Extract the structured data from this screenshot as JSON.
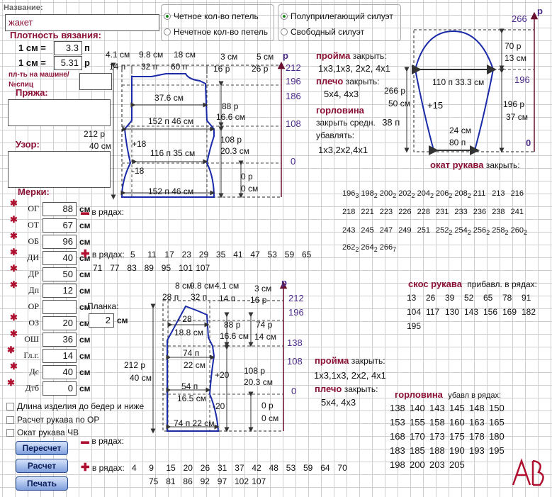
{
  "header": {
    "name_label": "Название:",
    "name_value": "жакет",
    "radio_even": "Четное кол-во петель",
    "radio_odd": "Нечетное кол-во петель",
    "radio_semi": "Полуприлегающий силуэт",
    "radio_free": "Свободный силуэт"
  },
  "density": {
    "title": "Плотность вязания:",
    "r1_left": "1 см =",
    "r1_value": "3.3",
    "r1_unit": "п",
    "r2_left": "1 см =",
    "r2_value": "5.31",
    "r2_unit": "р",
    "machine_label": "пл-ть на машине/",
    "needle_label": "№спиц"
  },
  "yarn_label": "Пряжа:",
  "pattern_label": "Узор:",
  "measures": {
    "title": "Мерки:",
    "unit": "см",
    "items": [
      {
        "label": "ОГ",
        "value": "88"
      },
      {
        "label": "ОТ",
        "value": "67"
      },
      {
        "label": "ОБ",
        "value": "96"
      },
      {
        "label": "ДИ",
        "value": "40"
      },
      {
        "label": "ДР",
        "value": "50"
      },
      {
        "label": "Дп",
        "value": "12"
      },
      {
        "label": "ОР",
        "value": ""
      },
      {
        "label": "ОЗ",
        "value": "20"
      },
      {
        "label": "ОШ",
        "value": "36"
      },
      {
        "label": "Гл.г.",
        "value": "14"
      },
      {
        "label": "Дс",
        "value": "40"
      },
      {
        "label": "Дтб",
        "value": "0"
      }
    ]
  },
  "planka": {
    "label": "Планка:",
    "value": "2",
    "unit": "см"
  },
  "checks": {
    "c1": "Длина изделия до бедер и ниже",
    "c2": "Расчет рукава по ОР",
    "c3": "Окат рукава ЧВ"
  },
  "buttons": {
    "recalc": "Пересчет",
    "calc": "Расчет",
    "print": "Печать"
  },
  "rows_label": "в рядах:",
  "back": {
    "dec_rows": [],
    "inc_rows_1": [
      "5",
      "11",
      "17",
      "23",
      "29",
      "35",
      "41",
      "47",
      "53",
      "59",
      "65"
    ],
    "inc_rows_2": [
      "71",
      "77",
      "83",
      "89",
      "95",
      "101",
      "107"
    ],
    "armhole_title": "пройма",
    "close_word": "закрыть:",
    "armhole_vals": "1х3,1х3,  2х2,  4х1",
    "shoulder_title": "плечо",
    "shoulder_vals": "5х4,  4х3",
    "neck_title": "горловина",
    "neck_close_mid": "закрыть средн.",
    "neck_close_val": "38 п",
    "neck_dec_label": "убавлять:",
    "neck_vals": "1х3,2х2,4х1"
  },
  "back_diagram": {
    "t_41": "4.1",
    "t_98": "9.8",
    "t_18": "18",
    "t_3": "3",
    "t_5": "5",
    "t_14": "14",
    "t_32": "32",
    "t_60": "60",
    "t_16": "16",
    "t_26": "26",
    "t_376": "37.6",
    "t_88": "88",
    "t_166": "16.6",
    "t_152a": "152",
    "t_46a": "46",
    "t_212": "212",
    "t_40": "40",
    "t_18p": "+18",
    "t_116": "116",
    "t_35": "35",
    "t_108": "108",
    "t_203": "20.3",
    "t_18m": "-18",
    "t_0p": "0",
    "t_0c": "0",
    "t_152b": "152",
    "t_46b": "46",
    "s_212": "212",
    "s_196": "196",
    "s_186": "186",
    "s_108": "108",
    "s_0": "0",
    "u_sm": "см",
    "u_p": "п",
    "u_r": "р"
  },
  "sleeve": {
    "cap_title": "окат рукава",
    "cap_close": "закрыть:",
    "cap_rows": [
      [
        [
          "196",
          "3"
        ],
        [
          "198",
          "2"
        ],
        [
          "200",
          "2"
        ],
        [
          "202",
          "2"
        ],
        [
          "204",
          "2"
        ],
        [
          "206",
          "2"
        ],
        [
          "208",
          "2"
        ],
        [
          "211",
          ""
        ],
        [
          "213",
          ""
        ],
        [
          "216",
          ""
        ]
      ],
      [
        [
          "218",
          ""
        ],
        [
          "221",
          ""
        ],
        [
          "223",
          ""
        ],
        [
          "226",
          ""
        ],
        [
          "228",
          ""
        ],
        [
          "231",
          ""
        ],
        [
          "233",
          ""
        ],
        [
          "236",
          ""
        ],
        [
          "238",
          ""
        ],
        [
          "241",
          ""
        ]
      ],
      [
        [
          "243",
          ""
        ],
        [
          "245",
          ""
        ],
        [
          "247",
          ""
        ],
        [
          "249",
          ""
        ],
        [
          "251",
          ""
        ],
        [
          "252",
          "2"
        ],
        [
          "254",
          "2"
        ],
        [
          "256",
          "2"
        ],
        [
          "258",
          "2"
        ],
        [
          "260",
          "2"
        ]
      ],
      [
        [
          "262",
          "2"
        ],
        [
          "264",
          "2"
        ],
        [
          "266",
          "7"
        ]
      ]
    ],
    "slope_title": "скос рукава",
    "slope_inc": "прибавл. в рядах:",
    "slope_rows": [
      [
        "13",
        "26",
        "39",
        "52",
        "65",
        "78",
        "91"
      ],
      [
        "104",
        "117",
        "130",
        "143",
        "156",
        "169",
        "182"
      ],
      [
        "195"
      ]
    ]
  },
  "sleeve_diagram": {
    "s_266": "266",
    "s_196": "196",
    "s_0": "0",
    "t_70": "70",
    "t_13": "13",
    "t_110": "110",
    "t_333": "33.3",
    "t_266": "266",
    "t_50": "50",
    "t_15": "+15",
    "t_196": "196",
    "t_37": "37",
    "t_24": "24",
    "t_80": "80",
    "u_sm": "см",
    "u_p": "п",
    "u_r": "р"
  },
  "front": {
    "armhole_title": "пройма",
    "close_word": "закрыть:",
    "armhole_vals": "1х3,1х3,  2х2,  4х1",
    "shoulder_title": "плечо",
    "shoulder_vals": "5х4,  4х3",
    "neck_title": "горловина",
    "neck_dec": "убавл в рядах:",
    "neck_rows": [
      [
        "138",
        "140",
        "143",
        "145",
        "148",
        "150"
      ],
      [
        "153",
        "155",
        "158",
        "160",
        "163",
        "165"
      ],
      [
        "168",
        "170",
        "173",
        "175",
        "178",
        "180"
      ],
      [
        "183",
        "185",
        "188",
        "190",
        "193",
        "195"
      ],
      [
        "198",
        "200",
        "203",
        "205"
      ]
    ],
    "inc_rows_1": [
      "4",
      "9",
      "15",
      "20",
      "26",
      "31",
      "37",
      "42",
      "48",
      "53",
      "59",
      "64",
      "70"
    ],
    "inc_rows_2": [
      "75",
      "81",
      "86",
      "92",
      "97",
      "102",
      "107"
    ]
  },
  "front_diagram": {
    "t_8": "8",
    "t_98": "9.8",
    "t_41": "4.1",
    "t_3": "3",
    "t_28": "28",
    "t_32": "32",
    "t_14": "14",
    "t_16": "16",
    "t_28m": "28",
    "t_188": "18.8",
    "t_88": "88",
    "t_166": "16.6",
    "t_74a": "74",
    "t_14b": "14",
    "t_74b": "74",
    "t_22": "22",
    "t_212": "212",
    "t_40": "40",
    "t_20p": "+20",
    "t_54": "54",
    "t_165": "16.5",
    "t_108": "108",
    "t_203": "20.3",
    "t_20m": "-20",
    "t_0p": "0",
    "t_0c": "0",
    "t_74c": "74",
    "t_22b": "22",
    "s_212": "212",
    "s_196": "196",
    "s_138": "138",
    "s_108": "108",
    "s_0": "0",
    "u_sm": "см",
    "u_p": "п",
    "u_r": "р"
  },
  "logo_text": "AB"
}
